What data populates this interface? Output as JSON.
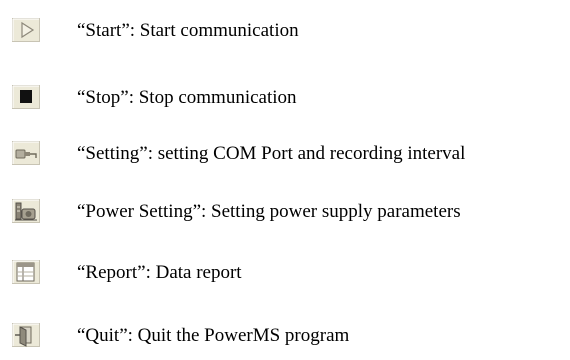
{
  "toolbar_legend": {
    "items": [
      {
        "icon": "start-icon",
        "text": "“Start”: Start communication"
      },
      {
        "icon": "stop-icon",
        "text": "“Stop”: Stop communication"
      },
      {
        "icon": "setting-icon",
        "text": "“Setting”: setting COM Port and recording interval"
      },
      {
        "icon": "power-setting-icon",
        "text": "“Power Setting”: Setting power supply parameters"
      },
      {
        "icon": "report-icon",
        "text": "“Report”: Data report"
      },
      {
        "icon": "quit-icon",
        "text": "“Quit”: Quit the PowerMS program"
      }
    ]
  }
}
